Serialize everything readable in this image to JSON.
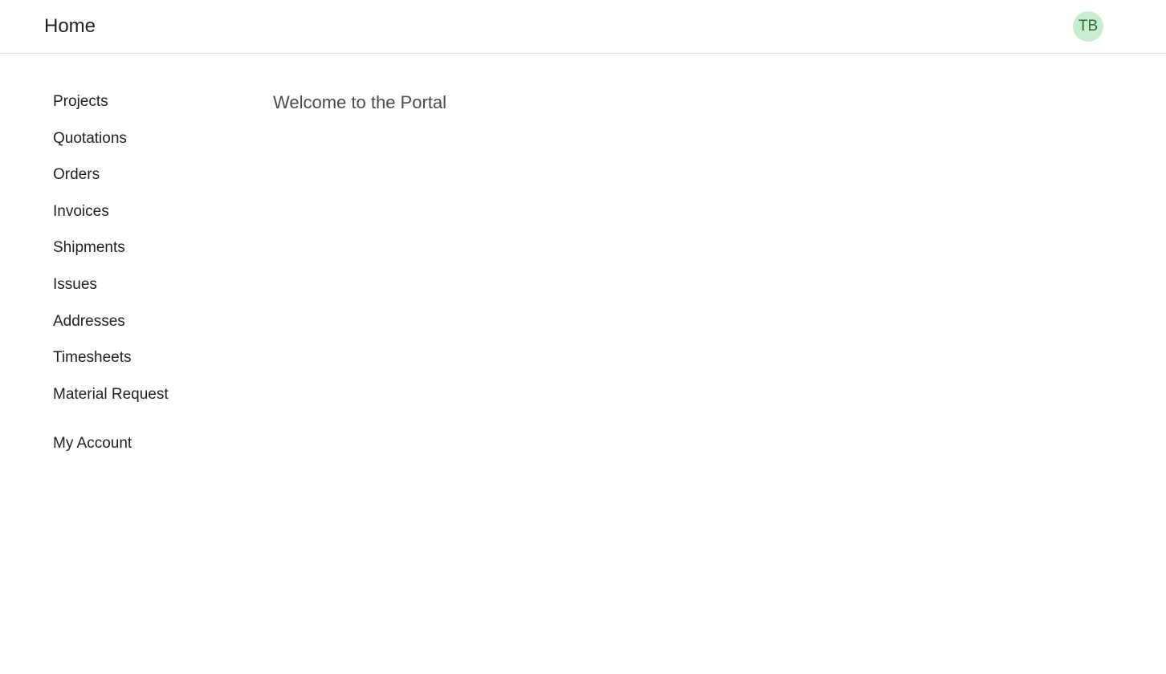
{
  "header": {
    "title": "Home",
    "avatar_initials": "TB",
    "avatar_color": "#c9ecd1"
  },
  "sidebar": {
    "items": [
      {
        "label": "Projects"
      },
      {
        "label": "Quotations"
      },
      {
        "label": "Orders"
      },
      {
        "label": "Invoices"
      },
      {
        "label": "Shipments"
      },
      {
        "label": "Issues"
      },
      {
        "label": "Addresses"
      },
      {
        "label": "Timesheets"
      },
      {
        "label": "Material Request"
      }
    ],
    "account_label": "My Account"
  },
  "main": {
    "heading": "Welcome to the Portal"
  }
}
